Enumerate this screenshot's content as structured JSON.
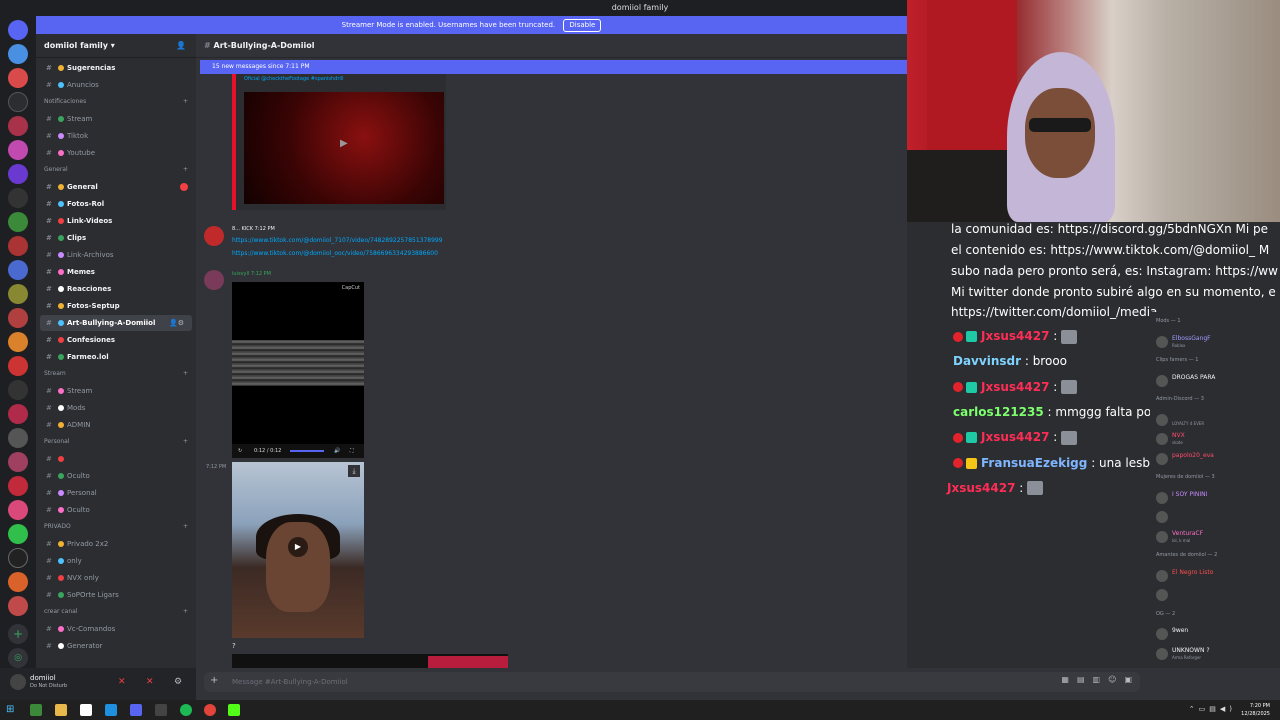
{
  "window": {
    "title": "domiiol family"
  },
  "banner": {
    "text": "Streamer Mode is enabled. Usernames have been truncated.",
    "button": "Disable"
  },
  "server": {
    "name": "domiiol family"
  },
  "sidebar": {
    "channels": [
      {
        "kind": "chan",
        "label": "Sugerencias",
        "bold": true,
        "y": 0
      },
      {
        "kind": "chan",
        "label": "Anuncios",
        "y": 1
      },
      {
        "kind": "cat",
        "label": "Notificaciones",
        "y": 2
      },
      {
        "kind": "chan",
        "label": "Stream",
        "y": 3
      },
      {
        "kind": "chan",
        "label": "Tiktok",
        "y": 4
      },
      {
        "kind": "chan",
        "label": "Youtube",
        "y": 5
      },
      {
        "kind": "cat",
        "label": "General",
        "y": 6
      },
      {
        "kind": "chan",
        "label": "General",
        "bold": true,
        "y": 7,
        "unread": true
      },
      {
        "kind": "chan",
        "label": "Fotos-Rol",
        "bold": true,
        "y": 8
      },
      {
        "kind": "chan",
        "label": "Link-Videos",
        "bold": true,
        "y": 9
      },
      {
        "kind": "chan",
        "label": "Clips",
        "bold": true,
        "y": 10
      },
      {
        "kind": "chan",
        "label": "Link-Archivos",
        "y": 11
      },
      {
        "kind": "chan",
        "label": "Memes",
        "bold": true,
        "y": 12
      },
      {
        "kind": "chan",
        "label": "Reacciones",
        "bold": true,
        "y": 13
      },
      {
        "kind": "chan",
        "label": "Fotos-Septup",
        "bold": true,
        "y": 14
      },
      {
        "kind": "chan",
        "label": "Art-Bullying-A-Domiiol",
        "active": true,
        "y": 15
      },
      {
        "kind": "chan",
        "label": "Confesiones",
        "bold": true,
        "y": 16
      },
      {
        "kind": "chan",
        "label": "Farmeo.lol",
        "bold": true,
        "y": 17
      },
      {
        "kind": "cat",
        "label": "Stream",
        "y": 18
      },
      {
        "kind": "chan",
        "label": "Stream",
        "y": 19
      },
      {
        "kind": "chan",
        "label": "Mods",
        "y": 20
      },
      {
        "kind": "chan",
        "label": "ADMIN",
        "y": 21
      },
      {
        "kind": "cat",
        "label": "Personal",
        "y": 22
      },
      {
        "kind": "chan",
        "label": "",
        "y": 23
      },
      {
        "kind": "chan",
        "label": "Oculto",
        "y": 24
      },
      {
        "kind": "chan",
        "label": "Personal",
        "y": 25
      },
      {
        "kind": "chan",
        "label": "Oculto",
        "y": 26
      },
      {
        "kind": "cat",
        "label": "PRIVADO",
        "y": 27
      },
      {
        "kind": "chan",
        "label": "Privado 2x2",
        "y": 28
      },
      {
        "kind": "chan",
        "label": "only",
        "y": 29
      },
      {
        "kind": "chan",
        "label": "NVX only",
        "y": 30
      },
      {
        "kind": "chan",
        "label": "SoPOrte Ligars",
        "y": 31
      },
      {
        "kind": "cat",
        "label": "crear canal",
        "y": 32
      },
      {
        "kind": "chan",
        "label": "Vc-Comandos",
        "y": 33
      },
      {
        "kind": "chan",
        "label": "Generator",
        "y": 34
      }
    ]
  },
  "user": {
    "name": "domiiol",
    "status": "Do Not Disturb"
  },
  "channel": {
    "name": "Art-Bullying-A-Domiiol",
    "new_messages": "15 new messages since 7:11 PM"
  },
  "messages": {
    "embed_caption": "Oficial @checktheFootage #spanishdrill",
    "msg1_name": "8... KICK  7:12 PM",
    "msg1_link1": "https://www.tiktok.com/@domiiol_7107/video/7482892257851378999",
    "msg1_link2": "https://www.tiktok.com/@domiiol_ooc/video/7586696334293886600",
    "msg2_name": "luisvyll  7:12 PM",
    "video_brand": "CapCut",
    "video_time": "0:12 / 0:12",
    "msg3_time": "7:12 PM",
    "qmark": "?"
  },
  "composer": {
    "placeholder": "Message #Art-Bullying-A-Domiiol"
  },
  "overlay": {
    "lines": [
      "la comunidad es: https://discord.gg/5bdnNGXn Mi pe",
      "el contenido es: https://www.tiktok.com/@domiiol_ M",
      "subo nada pero pronto será, es: Instagram: https://ww",
      "Mi twitter donde pronto subiré algo en su momento, e",
      "https://twitter.com/domiiol_/media"
    ],
    "chat": [
      {
        "user": "Jxsus4427",
        "msg": "",
        "color": "#ff2d55",
        "badges": 2
      },
      {
        "user": "Davvinsdr",
        "msg": " : brooo",
        "color": "#7fd3ff",
        "badges": 0
      },
      {
        "user": "Jxsus4427",
        "msg": "",
        "color": "#ff2d55",
        "badges": 2
      },
      {
        "user": "carlos121235",
        "msg": " : mmggg falta poco para mi glorioso h",
        "color": "#7dff6e",
        "badges": 0
      },
      {
        "user": "Jxsus4427",
        "msg": "",
        "color": "#ff2d55",
        "badges": 2
      },
      {
        "user": "FransuaEzekigg",
        "msg": " : una lesbiana.",
        "color": "#7fb6ff",
        "badges": 3
      },
      {
        "user": "Jxsus4427",
        "msg": "",
        "color": "#ff2d55",
        "badges": 0
      }
    ]
  },
  "members": {
    "sections": [
      {
        "type": "cat",
        "label": "Mods — 1",
        "y": 0
      },
      {
        "type": "mem",
        "name": "ElbossGangF",
        "sub": "Roblox",
        "color": "#a29bff",
        "y": 1
      },
      {
        "type": "cat",
        "label": "Clips famers — 1",
        "y": 2
      },
      {
        "type": "mem",
        "name": "DROGAS PARA",
        "sub": "",
        "color": "#f2f3f5",
        "y": 3
      },
      {
        "type": "cat",
        "label": "Admin-Discord — 3",
        "y": 4
      },
      {
        "type": "mem",
        "name": "",
        "sub": "LOYALTY 4 EVER",
        "color": "#f2f3f5",
        "y": 5
      },
      {
        "type": "mem",
        "name": "NVX",
        "sub": "skate",
        "color": "#ff4d6d",
        "y": 6
      },
      {
        "type": "mem",
        "name": "papolo20_eva",
        "sub": "",
        "color": "#ff4d6d",
        "y": 7
      },
      {
        "type": "cat",
        "label": "Mujeres de domiiol — 3",
        "y": 8
      },
      {
        "type": "mem",
        "name": "I SOY PININI",
        "sub": "",
        "color": "#c98bff",
        "y": 9
      },
      {
        "type": "mem",
        "name": "",
        "sub": "",
        "color": "#c98bff",
        "y": 10
      },
      {
        "type": "mem",
        "name": "VenturaCF",
        "sub": "lol, k mal",
        "color": "#ff6ec7",
        "y": 11
      },
      {
        "type": "cat",
        "label": "Amantes de domiiol — 2",
        "y": 12
      },
      {
        "type": "mem",
        "name": "El Negro Listo",
        "sub": "",
        "color": "#ff4d4d",
        "y": 13
      },
      {
        "type": "mem",
        "name": "",
        "sub": "",
        "color": "#ff4d4d",
        "y": 14
      },
      {
        "type": "cat",
        "label": "OG — 2",
        "y": 15
      },
      {
        "type": "mem",
        "name": "9wen",
        "sub": "",
        "color": "#f2f3f5",
        "y": 16
      },
      {
        "type": "mem",
        "name": "UNKNOWN ?",
        "sub": "Arma Reforger",
        "color": "#f2f3f5",
        "y": 17
      }
    ]
  },
  "taskbar": {
    "time": "7:20 PM",
    "date": "12/28/2025"
  },
  "colors": {
    "accent": "#5865f2",
    "danger": "#f23f43",
    "background": "#313338"
  }
}
